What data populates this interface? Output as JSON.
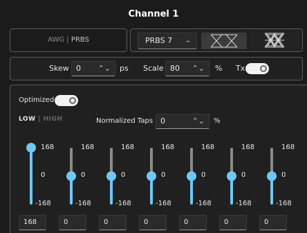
{
  "header": {
    "title": "Channel 1"
  },
  "mode_selector": {
    "option_awg": "AWG",
    "separator": " | ",
    "option_prbs": "PRBS"
  },
  "pattern": {
    "selected": "PRBS 7",
    "chevron": "chevron-down-icon"
  },
  "skew": {
    "label": "Skew",
    "value": "0",
    "unit": "ps"
  },
  "scale": {
    "label": "Scale",
    "value": "80",
    "unit": "%"
  },
  "tx": {
    "label": "Tx",
    "state": "on"
  },
  "optimized": {
    "label": "Optimized",
    "state": "on"
  },
  "range": {
    "low": "LOW",
    "separator": " | ",
    "high": "HIGH"
  },
  "normalized_taps": {
    "label": "Normalized Taps",
    "value": "0",
    "unit": "%"
  },
  "taps": [
    {
      "max": "168",
      "mid": "0",
      "min": "-168",
      "value": "168",
      "level": 1.0
    },
    {
      "max": "168",
      "mid": "0",
      "min": "-168",
      "value": "0",
      "level": 0.5
    },
    {
      "max": "168",
      "mid": "0",
      "min": "-168",
      "value": "0",
      "level": 0.5
    },
    {
      "max": "168",
      "mid": "0",
      "min": "-168",
      "value": "0",
      "level": 0.5
    },
    {
      "max": "168",
      "mid": "0",
      "min": "-168",
      "value": "0",
      "level": 0.5
    },
    {
      "max": "168",
      "mid": "0",
      "min": "-168",
      "value": "0",
      "level": 0.5
    },
    {
      "max": "168",
      "mid": "0",
      "min": "-168",
      "value": "0",
      "level": 0.5
    }
  ],
  "colors": {
    "accent": "#6ec8f5",
    "background": "#1b1b1b",
    "border": "#5a5a5a"
  }
}
